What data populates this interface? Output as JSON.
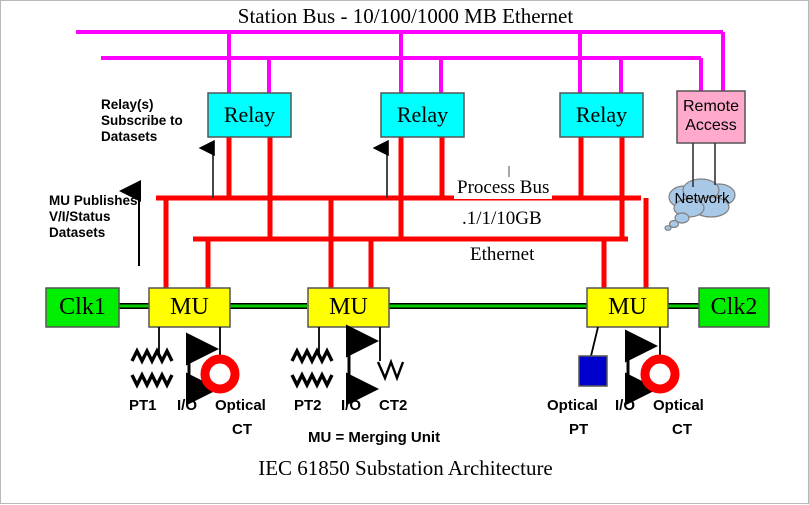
{
  "diagram": {
    "title_top": "Station Bus - 10/100/1000 MB Ethernet",
    "caption": "IEC 61850 Substation Architecture",
    "legend_note": "MU = Merging Unit",
    "process_bus_lines": {
      "line1": "Process Bus",
      "line2": ".1/1/10GB",
      "line3": "Ethernet"
    },
    "annotations": {
      "relay_note": "Relay(s)\nSubscribe to\nDatasets",
      "mu_note": "MU Publishes\nV/I/Status\nDatasets"
    },
    "nodes": {
      "relay1": "Relay",
      "relay2": "Relay",
      "relay3": "Relay",
      "remote_access": "Remote\nAccess",
      "network_cloud": "Network",
      "clk1": "Clk1",
      "clk2": "Clk2",
      "mu1": "MU",
      "mu2": "MU",
      "mu3": "MU"
    },
    "device_labels": {
      "pt1": "PT1",
      "io1": "I/O",
      "optical_ct1_l1": "Optical",
      "optical_ct1_l2": "CT",
      "pt2": "PT2",
      "io2": "I/O",
      "ct2": "CT2",
      "optical_pt_l1": "Optical",
      "optical_pt_l2": "PT",
      "io3": "I/O",
      "optical_ct3_l1": "Optical",
      "optical_ct3_l2": "CT"
    },
    "colors": {
      "station_bus": "#FF00FF",
      "process_bus": "#FF0000",
      "relay_fill": "#00FFFF",
      "remote_fill": "#FFAACC",
      "cloud_fill": "#A8C8E8",
      "clk_fill": "#00EE00",
      "mu_fill": "#FFFF00",
      "optical_ct": "#FF0000",
      "optical_pt": "#0000CC",
      "clock_link": "#00CC00",
      "stroke": "#000000"
    }
  }
}
